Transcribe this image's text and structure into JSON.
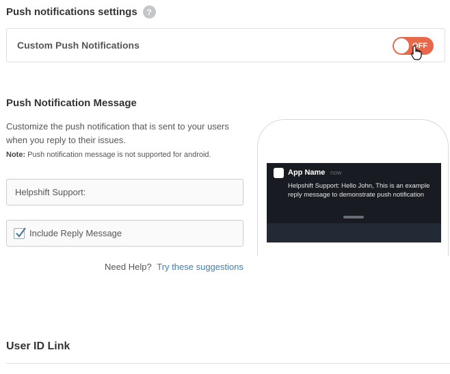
{
  "push_settings": {
    "title": "Push notifications settings",
    "help_icon_text": "?",
    "custom_push_label": "Custom Push Notifications",
    "toggle_state_text": "OFF"
  },
  "message": {
    "title": "Push Notification Message",
    "description": "Customize the push notification that is sent to your users when you reply to their issues.",
    "note_label": "Note:",
    "note_text": " Push notification message is not supported for android.",
    "prefix_input_value": "Helpshift Support:",
    "include_reply_label": "Include Reply Message",
    "include_reply_checked": true,
    "help_text": "Need Help?",
    "help_link": "Try these suggestions"
  },
  "preview": {
    "app_name": "App Name",
    "time": "now",
    "body": "Helpshift Support: Hello John, This is an example reply message to demonstrate push notification"
  },
  "user_id": {
    "title": "User ID Link"
  },
  "colors": {
    "toggle_off": "#e8694a",
    "link": "#3d7fb5",
    "notification_bg": "#181c22"
  }
}
